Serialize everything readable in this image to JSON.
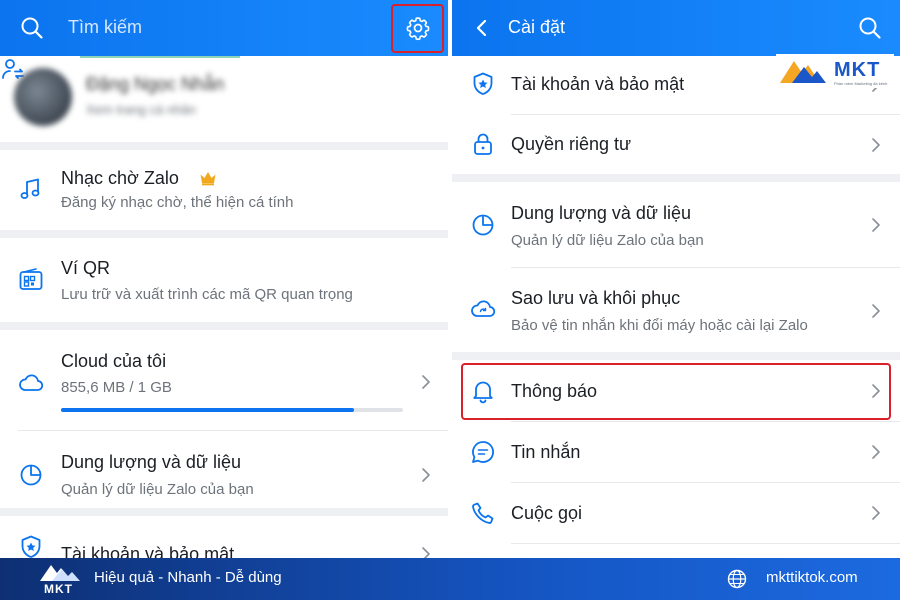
{
  "left": {
    "search_placeholder": "Tìm kiếm",
    "profile": {
      "name": "Đặng Ngọc Nhẫn",
      "subtitle": "Xem trang cá nhân"
    },
    "items": [
      {
        "title": "Nhạc chờ Zalo",
        "subtitle": "Đăng ký nhạc chờ, thể hiện cá tính",
        "icon": "music-icon"
      },
      {
        "title": "Ví QR",
        "subtitle": "Lưu trữ và xuất trình các mã QR quan trọng",
        "icon": "qr-wallet-icon"
      },
      {
        "title": "Cloud của tôi",
        "subtitle": "855,6 MB / 1 GB",
        "icon": "cloud-icon",
        "progress": 0.856
      },
      {
        "title": "Dung lượng và dữ liệu",
        "subtitle": "Quản lý dữ liệu Zalo của bạn",
        "icon": "pie-chart-icon"
      },
      {
        "title": "Tài khoản và bảo mật",
        "icon": "shield-icon"
      }
    ]
  },
  "right": {
    "header_title": "Cài đặt",
    "items": [
      {
        "title": "Tài khoản và bảo mật",
        "icon": "shield-icon"
      },
      {
        "title": "Quyền riêng tư",
        "icon": "lock-icon"
      },
      {
        "title": "Dung lượng và dữ liệu",
        "subtitle": "Quản lý dữ liệu Zalo của bạn",
        "icon": "pie-chart-icon"
      },
      {
        "title": "Sao lưu và khôi phục",
        "subtitle": "Bảo vệ tin nhắn khi đổi máy hoặc cài lại Zalo",
        "icon": "cloud-sync-icon"
      },
      {
        "title": "Thông báo",
        "icon": "bell-icon"
      },
      {
        "title": "Tin nhắn",
        "icon": "message-icon"
      },
      {
        "title": "Cuộc gọi",
        "icon": "phone-icon"
      }
    ]
  },
  "branding": {
    "logo_text": "MKT",
    "logo_tagline": "Phần mềm Marketing đa kênh",
    "footer_logo": "MKT",
    "slogan": "Hiệu quả - Nhanh - Dễ dùng",
    "website": "mkttiktok.com"
  },
  "colors": {
    "primary": "#0B74EE",
    "highlight": "#D9202B",
    "premium": "#F2A81D",
    "footer": "#1556C4"
  }
}
